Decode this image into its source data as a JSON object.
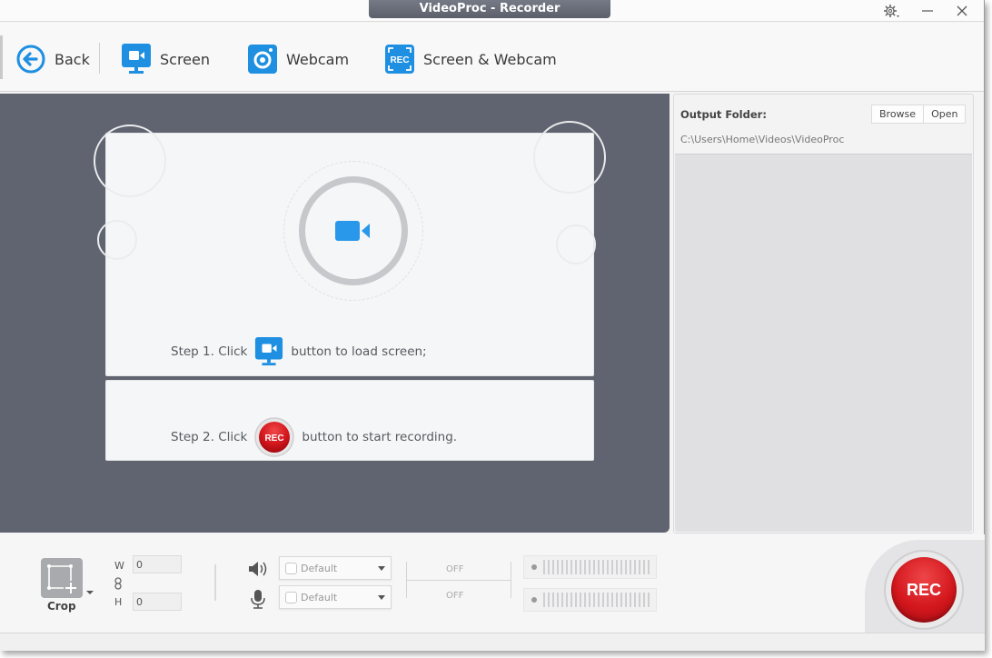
{
  "window": {
    "title": "VideoProc - Recorder"
  },
  "titlebar_buttons": {
    "settings": "settings-icon",
    "minimize": "minimize-icon",
    "close": "close-icon"
  },
  "toolbar": {
    "back_label": "Back",
    "items": [
      {
        "label": "Screen",
        "icon": "screen-camera-icon"
      },
      {
        "label": "Webcam",
        "icon": "webcam-icon"
      },
      {
        "label": "Screen & Webcam",
        "icon": "rec-frame-icon",
        "icon_text": "REC"
      }
    ],
    "accent": "#1e8fe1"
  },
  "preview": {
    "step1_prefix": "Step 1. Click",
    "step1_suffix": "button to load screen;",
    "step2_prefix": "Step 2. Click",
    "step2_suffix": "button to start recording.",
    "rec_icon_text": "REC"
  },
  "output": {
    "label": "Output Folder:",
    "browse_label": "Browse",
    "open_label": "Open",
    "path": "C:\\Users\\Home\\Videos\\VideoProc"
  },
  "bottom": {
    "crop_label": "Crop",
    "w_label": "W",
    "h_label": "H",
    "w_value": "0",
    "h_value": "0",
    "speaker_device": "Default",
    "mic_device": "Default",
    "speaker_state": "OFF",
    "mic_state": "OFF",
    "rec_label": "REC",
    "rec_color": "#d3171d"
  }
}
